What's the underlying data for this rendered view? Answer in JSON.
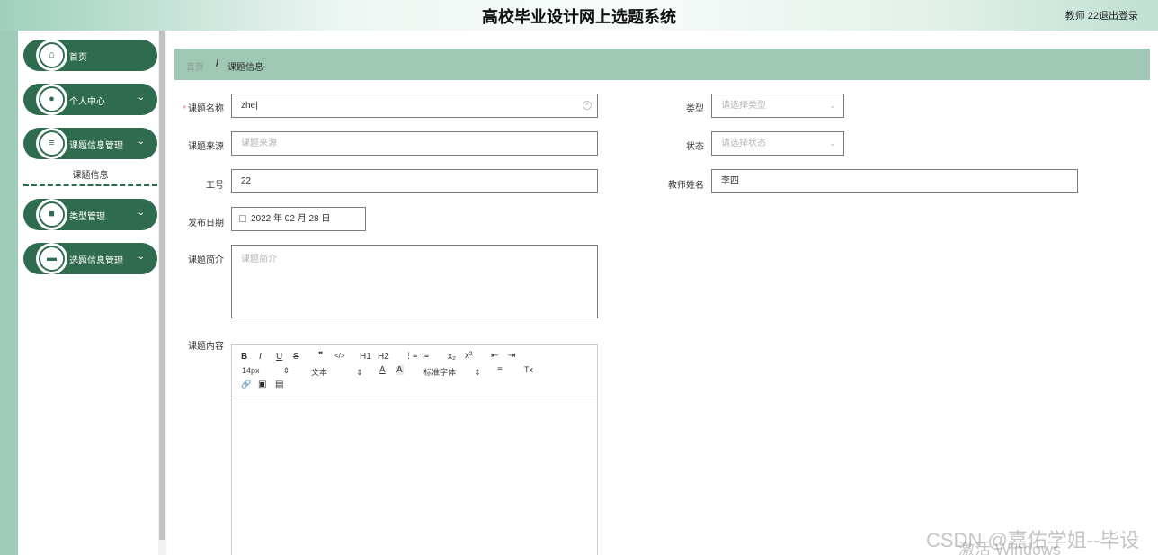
{
  "header": {
    "title": "高校毕业设计网上选题系统",
    "user": "教师 22",
    "logout": "退出登录"
  },
  "sidebar": {
    "items": [
      {
        "label": "首页",
        "icon": "home-icon",
        "glyph": "⌂"
      },
      {
        "label": "个人中心",
        "icon": "user-icon",
        "glyph": "●"
      },
      {
        "label": "课题信息管理",
        "icon": "sliders-icon",
        "glyph": "≡"
      },
      {
        "label": "类型管理",
        "icon": "book-icon",
        "glyph": "■"
      },
      {
        "label": "选题信息管理",
        "icon": "database-icon",
        "glyph": "▬"
      }
    ],
    "submenu_label": "课题信息",
    "chevron": "⌄"
  },
  "breadcrumb": {
    "home": "首页",
    "separator": "/",
    "current": "课题信息"
  },
  "form": {
    "required_mark": "*",
    "title_label": "课题名称",
    "title_value": "zhe|",
    "type_label": "类型",
    "type_placeholder": "请选择类型",
    "source_label": "课题来源",
    "source_placeholder": "课题来源",
    "status_label": "状态",
    "status_placeholder": "请选择状态",
    "job_no_label": "工号",
    "job_no_value": "22",
    "teacher_label": "教师姓名",
    "teacher_value": "李四",
    "date_label": "发布日期",
    "date_value": "2022 年 02 月 28 日",
    "intro_label": "课题简介",
    "intro_placeholder": "课题简介",
    "content_label": "课题内容"
  },
  "editor": {
    "bold": "B",
    "italic": "I",
    "underline": "U",
    "strike": "S",
    "quote": "❞",
    "code": "</>",
    "h1": "H1",
    "h2": "H2",
    "ol": "⋮≡",
    "ul": "⁝≡",
    "sub": "x₂",
    "sup": "x²",
    "outdent": "⇤",
    "indent": "⇥",
    "size": "14px",
    "format": "文本",
    "color": "A",
    "bg": "A",
    "font": "标准字体",
    "align": "≡",
    "clear": "Tx",
    "link": "🔗",
    "image": "▣",
    "video": "▤",
    "spin": "⇕"
  },
  "watermark": {
    "csdn": "CSDN @嘉佑学姐--毕设",
    "windows": "激活 Windows"
  },
  "colors": {
    "primary": "#2e6b4f",
    "breadcrumb_bg": "#9fc8b4",
    "strip": "#9fccb8"
  }
}
